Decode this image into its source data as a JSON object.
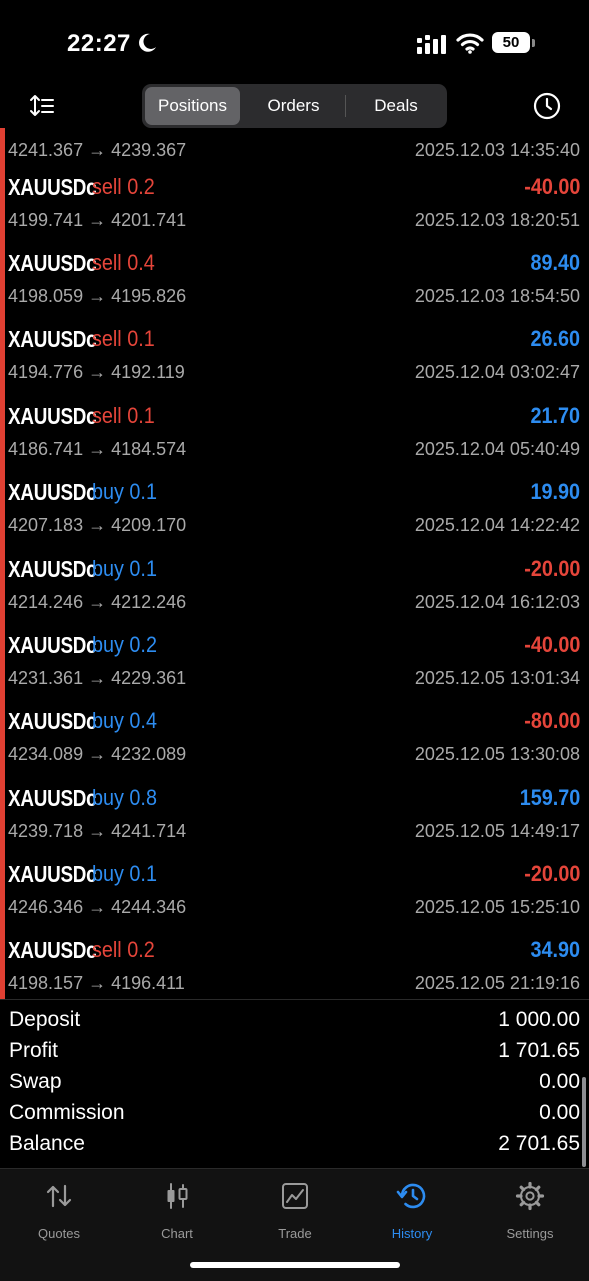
{
  "status": {
    "time": "22:27",
    "battery": "50",
    "icons": [
      "moon-icon",
      "signal-icon",
      "wifi-icon",
      "battery-icon"
    ]
  },
  "header": {
    "tabs": [
      {
        "label": "Positions",
        "active": true
      },
      {
        "label": "Orders",
        "active": false
      },
      {
        "label": "Deals",
        "active": false
      }
    ],
    "left_icon": "sort-icon",
    "right_icon": "clock-icon"
  },
  "colors": {
    "sell": "#e5453a",
    "buy": "#2d8cf0",
    "negative": "#e5453a",
    "positive": "#2d8cf0",
    "accent": "#2d8cf0",
    "loss_bar": "#e04033"
  },
  "deals": [
    {
      "symbol": "",
      "side": "",
      "prices": "4241.367 → 4239.367",
      "profit": "",
      "time": "2025.12.03 14:35:40",
      "partial": true
    },
    {
      "symbol": "XAUUSDc",
      "side": "sell 0.2",
      "type": "sell",
      "prices": "4199.741 → 4201.741",
      "profit": "-40.00",
      "time": "2025.12.03 18:20:51"
    },
    {
      "symbol": "XAUUSDc",
      "side": "sell 0.4",
      "type": "sell",
      "prices": "4198.059 → 4195.826",
      "profit": "89.40",
      "time": "2025.12.03 18:54:50"
    },
    {
      "symbol": "XAUUSDc",
      "side": "sell 0.1",
      "type": "sell",
      "prices": "4194.776 → 4192.119",
      "profit": "26.60",
      "time": "2025.12.04 03:02:47"
    },
    {
      "symbol": "XAUUSDc",
      "side": "sell 0.1",
      "type": "sell",
      "prices": "4186.741 → 4184.574",
      "profit": "21.70",
      "time": "2025.12.04 05:40:49"
    },
    {
      "symbol": "XAUUSDc",
      "side": "buy 0.1",
      "type": "buy",
      "prices": "4207.183 → 4209.170",
      "profit": "19.90",
      "time": "2025.12.04 14:22:42"
    },
    {
      "symbol": "XAUUSDc",
      "side": "buy 0.1",
      "type": "buy",
      "prices": "4214.246 → 4212.246",
      "profit": "-20.00",
      "time": "2025.12.04 16:12:03"
    },
    {
      "symbol": "XAUUSDc",
      "side": "buy 0.2",
      "type": "buy",
      "prices": "4231.361 → 4229.361",
      "profit": "-40.00",
      "time": "2025.12.05 13:01:34"
    },
    {
      "symbol": "XAUUSDc",
      "side": "buy 0.4",
      "type": "buy",
      "prices": "4234.089 → 4232.089",
      "profit": "-80.00",
      "time": "2025.12.05 13:30:08"
    },
    {
      "symbol": "XAUUSDc",
      "side": "buy 0.8",
      "type": "buy",
      "prices": "4239.718 → 4241.714",
      "profit": "159.70",
      "time": "2025.12.05 14:49:17"
    },
    {
      "symbol": "XAUUSDc",
      "side": "buy 0.1",
      "type": "buy",
      "prices": "4246.346 → 4244.346",
      "profit": "-20.00",
      "time": "2025.12.05 15:25:10"
    },
    {
      "symbol": "XAUUSDc",
      "side": "sell 0.2",
      "type": "sell",
      "prices": "4198.157 → 4196.411",
      "profit": "34.90",
      "time": "2025.12.05 21:19:16"
    }
  ],
  "summary": [
    {
      "label": "Deposit",
      "value": "1 000.00"
    },
    {
      "label": "Profit",
      "value": "1 701.65"
    },
    {
      "label": "Swap",
      "value": "0.00"
    },
    {
      "label": "Commission",
      "value": "0.00"
    },
    {
      "label": "Balance",
      "value": "2 701.65"
    }
  ],
  "tab_bar": [
    {
      "label": "Quotes",
      "icon": "quotes-icon",
      "active": false
    },
    {
      "label": "Chart",
      "icon": "chart-icon",
      "active": false
    },
    {
      "label": "Trade",
      "icon": "trade-icon",
      "active": false
    },
    {
      "label": "History",
      "icon": "history-icon",
      "active": true
    },
    {
      "label": "Settings",
      "icon": "settings-icon",
      "active": false
    }
  ]
}
